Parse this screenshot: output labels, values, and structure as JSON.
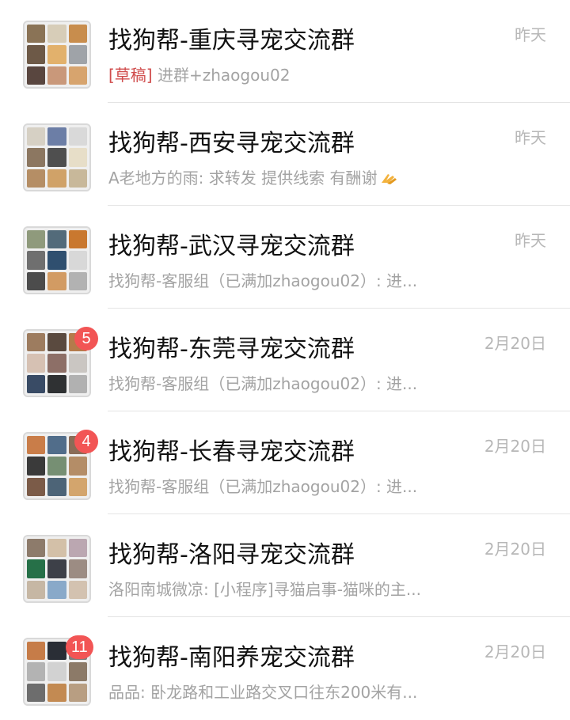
{
  "chats": [
    {
      "title": "找狗帮-重庆寻宠交流群",
      "draft_label": "[草稿]",
      "preview": "进群+zhaogou02",
      "time": "昨天",
      "badge": "",
      "avatar_icon": "group-avatar-icon"
    },
    {
      "title": "找狗帮-西安寻宠交流群",
      "preview": "A老地方的雨: 求转发 提供线索 有酬谢",
      "preview_emoji": "clap-icon",
      "time": "昨天",
      "badge": "",
      "avatar_icon": "group-avatar-icon"
    },
    {
      "title": "找狗帮-武汉寻宠交流群",
      "preview": "找狗帮-客服组（已满加zhaogou02）: 进...",
      "time": "昨天",
      "badge": "",
      "avatar_icon": "group-avatar-icon"
    },
    {
      "title": "找狗帮-东莞寻宠交流群",
      "preview": "找狗帮-客服组（已满加zhaogou02）: 进...",
      "time": "2月20日",
      "badge": "5",
      "avatar_icon": "group-avatar-icon"
    },
    {
      "title": "找狗帮-长春寻宠交流群",
      "preview": "找狗帮-客服组（已满加zhaogou02）: 进...",
      "time": "2月20日",
      "badge": "4",
      "avatar_icon": "group-avatar-icon"
    },
    {
      "title": "找狗帮-洛阳寻宠交流群",
      "preview": "洛阳南城微凉: [小程序]寻猫启事-猫咪的主...",
      "time": "2月20日",
      "badge": "",
      "avatar_icon": "group-avatar-icon"
    },
    {
      "title": "找狗帮-南阳养宠交流群",
      "preview": "品品: 卧龙路和工业路交叉口往东200米有...",
      "time": "2月20日",
      "badge": "11",
      "avatar_icon": "group-avatar-icon"
    }
  ],
  "colors": {
    "title": "#111111",
    "preview": "#a3a3a3",
    "time": "#b7b7b7",
    "draft": "#d04c4c",
    "badge": "#f25555",
    "divider": "#e4e4e4"
  }
}
